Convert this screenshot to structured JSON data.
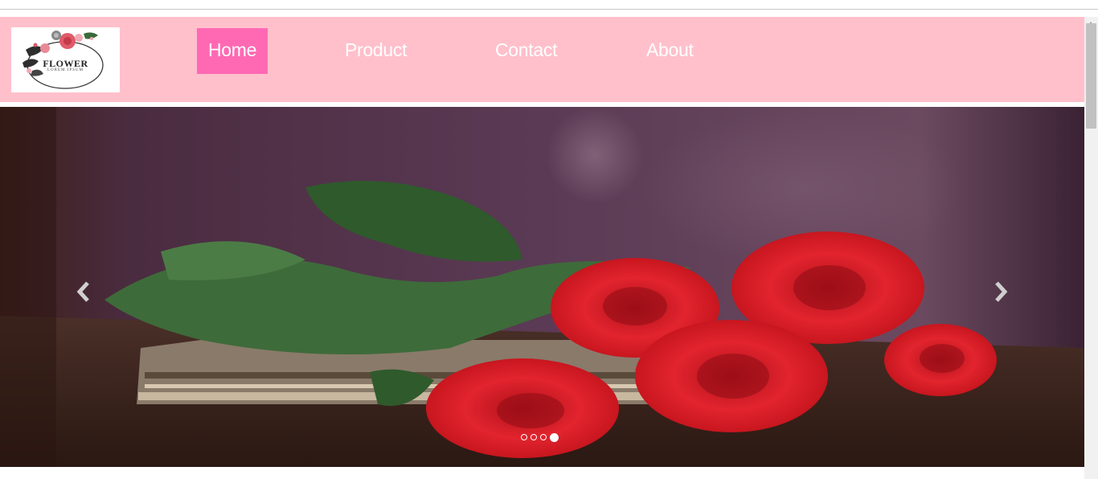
{
  "logo": {
    "alt": "Flower logo",
    "title": "FLOWER",
    "subtitle": "LOREM IPSUM"
  },
  "nav": {
    "items": [
      {
        "label": "Home",
        "active": true
      },
      {
        "label": "Product",
        "active": false
      },
      {
        "label": "Contact",
        "active": false
      },
      {
        "label": "About",
        "active": false
      }
    ]
  },
  "carousel": {
    "image": "red-roses-photo",
    "prev_icon": "chevron-left-icon",
    "next_icon": "chevron-right-icon",
    "slide_count": 4,
    "active_slide": 4
  },
  "colors": {
    "nav_bg": "#ffc0cb",
    "nav_active_bg": "#ff69b4",
    "nav_text": "#ffffff"
  }
}
